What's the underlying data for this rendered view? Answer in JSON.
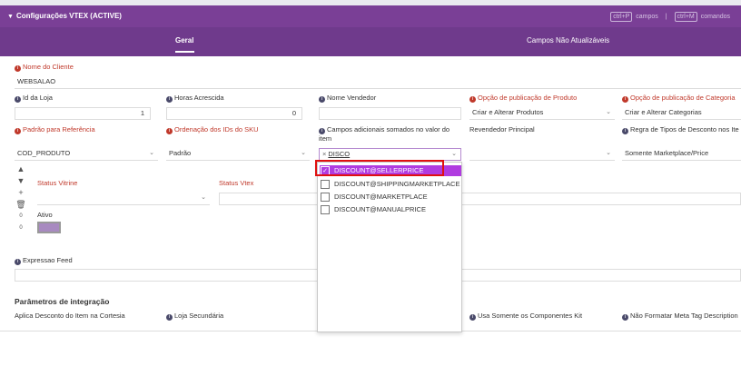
{
  "panel": {
    "title": "Configurações VTEX (ACTIVE)",
    "shortcut_campos_key": "ctrl+P",
    "shortcut_campos_label": "campos",
    "separator": "|",
    "shortcut_comandos_key": "ctrl+M",
    "shortcut_comandos_label": "comandos"
  },
  "tabs": [
    {
      "label": "Geral",
      "active": true
    },
    {
      "label": "Campos Não Atualizáveis",
      "active": false
    }
  ],
  "fields": {
    "nome_cliente": {
      "label": "Nome do Cliente",
      "value": "WEBSALAO"
    },
    "id_loja": {
      "label": "Id da Loja",
      "value": "1"
    },
    "horas_acrescida": {
      "label": "Horas Acrescida",
      "value": "0"
    },
    "nome_vendedor": {
      "label": "Nome Vendedor",
      "value": ""
    },
    "opcao_pub_produto": {
      "label": "Opção de publicação de Produto",
      "value": "Criar e Alterar Produtos"
    },
    "opcao_pub_categoria": {
      "label": "Opção de publicação de Categoria",
      "value": "Criar e Alterar Categorias"
    },
    "padrao_referencia": {
      "label": "Padrão para Referência",
      "value": "COD_PRODUTO"
    },
    "ordenacao_ids_sku": {
      "label": "Ordenação dos IDs do SKU",
      "value": "Padrão"
    },
    "campos_adicionais": {
      "label": "Campos adicionais somados no valor do item",
      "value": "DISCO",
      "remove": "×"
    },
    "revendedor_principal": {
      "label": "Revendedor Principal",
      "value": ""
    },
    "regra_tipos_desconto": {
      "label": "Regra de Tipos de Desconto nos Ite",
      "value": "Somente Marketplace/Price"
    },
    "status_vitrine": {
      "label": "Status Vitrine",
      "value": ""
    },
    "status_vtex": {
      "label": "Status Vtex",
      "value": ""
    },
    "ativo": {
      "label": "Ativo",
      "color": "#a88ac0"
    },
    "expressao_feed": {
      "label": "Expressao Feed",
      "value": ""
    }
  },
  "side_buttons": [
    "▲",
    "▼",
    "+",
    "🗑",
    "0",
    "0"
  ],
  "dropdown_options": [
    {
      "label": "DISCOUNT@SELLERPRICE",
      "checked": true
    },
    {
      "label": "DISCOUNT@SHIPPINGMARKETPLACE",
      "checked": false
    },
    {
      "label": "DISCOUNT@MARKETPLACE",
      "checked": false
    },
    {
      "label": "DISCOUNT@MANUALPRICE",
      "checked": false
    }
  ],
  "integration": {
    "section_title": "Parâmetros de integração",
    "aplica_desconto": "Aplica Desconto do Item na Cortesia",
    "loja_secundaria": "Loja Secundária",
    "usa_somente_componentes": "Usa Somente os Componentes Kit",
    "nao_formatar_meta": "Não Formatar Meta Tag Description"
  },
  "colors": {
    "header": "#7a3f96",
    "tabbar": "#6f3a8c",
    "selected_option": "#b03be0",
    "required_label": "#c0392b",
    "highlight_box": "#e01010"
  }
}
